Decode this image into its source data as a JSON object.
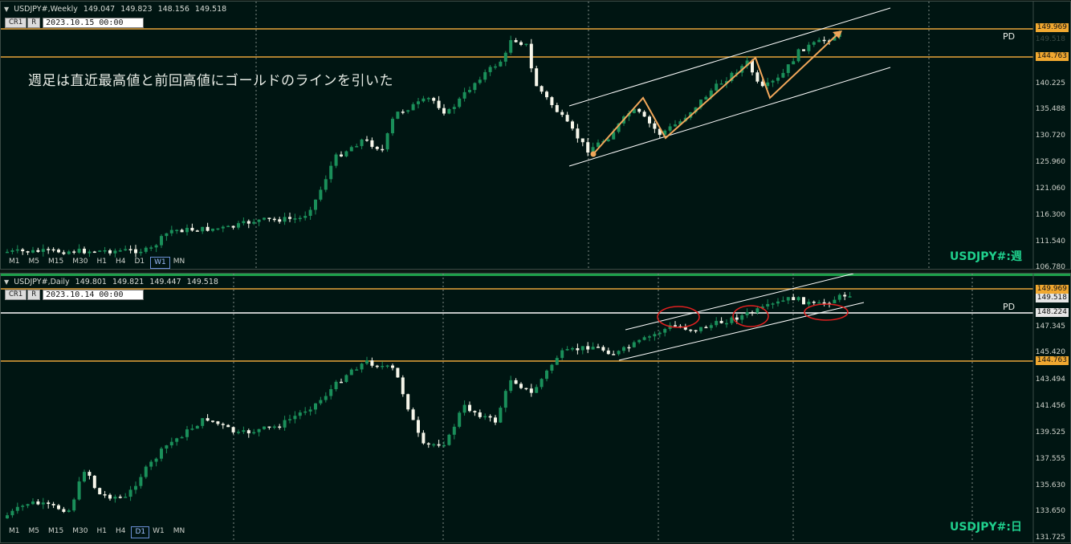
{
  "colors": {
    "bull": "#1a8f5a",
    "bear": "#f6f6ea",
    "gold": "#e7a43a",
    "arrow": "#f0a65a",
    "circle": "#e02020",
    "label": "#1fd08d",
    "bg": "#001512"
  },
  "weekly": {
    "header": {
      "symbol": "USDJPY#,Weekly",
      "open": "149.047",
      "high": "149.823",
      "low": "148.156",
      "close": "149.518"
    },
    "buttons": {
      "cr1": "CR1",
      "r": "R"
    },
    "date_box": "2023.10.15 00:00",
    "timeframes": [
      "M1",
      "M5",
      "M15",
      "M30",
      "H1",
      "H4",
      "D1",
      "W1",
      "MN"
    ],
    "active_tf": "W1",
    "label": "USDJPY#:週",
    "annotation": "週足は直近最高値と前回高値にゴールドのラインを引いた",
    "pd": "PD",
    "ticks": [
      "149.969",
      "140.225",
      "135.488",
      "130.720",
      "125.960",
      "121.060",
      "116.300",
      "111.540",
      "106.780"
    ],
    "price_tags": {
      "gold_top": "149.969",
      "gold_mid": "144.763"
    },
    "overlap_tag": "149.518"
  },
  "daily": {
    "header": {
      "symbol": "USDJPY#,Daily",
      "open": "149.801",
      "high": "149.821",
      "low": "149.447",
      "close": "149.518"
    },
    "buttons": {
      "cr1": "CR1",
      "r": "R"
    },
    "date_box": "2023.10.14 00:00",
    "timeframes": [
      "M1",
      "M5",
      "M15",
      "M30",
      "H1",
      "H4",
      "D1",
      "W1",
      "MN"
    ],
    "active_tf": "D1",
    "label": "USDJPY#:日",
    "pd": "PD",
    "ticks": [
      "147.345",
      "145.420",
      "143.494",
      "141.456",
      "139.525",
      "137.555",
      "135.630",
      "133.650",
      "131.725"
    ],
    "price_tags": {
      "gold_top": "149.969",
      "current": "149.518",
      "white": "148.224",
      "gold_low": "144.763"
    }
  }
}
